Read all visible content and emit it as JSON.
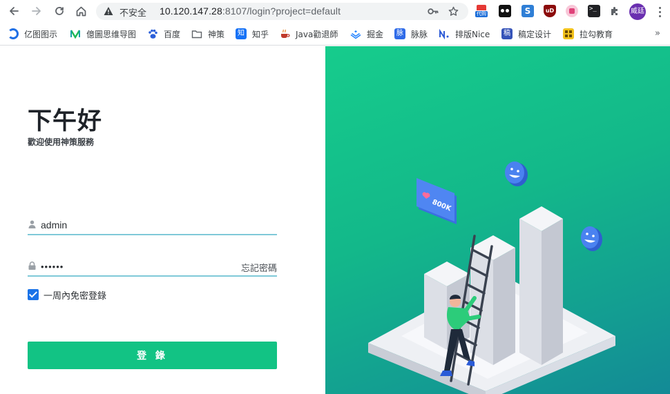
{
  "browser": {
    "security_label": "不安全",
    "url_host": "10.120.147.28",
    "url_rest": ":8107/login?project=default",
    "avatar_text": "威廷",
    "extensions": [
      "代购",
      "S",
      "uD"
    ],
    "bookmarks": [
      {
        "label": "亿图图示",
        "icon": "edraw-icon"
      },
      {
        "label": "億圖思维导图",
        "icon": "mindmaster-icon"
      },
      {
        "label": "百度",
        "icon": "baidu-paw-icon"
      },
      {
        "label": "神策",
        "icon": "folder-icon"
      },
      {
        "label": "知乎",
        "icon": "zhihu-icon"
      },
      {
        "label": "Java勸退師",
        "icon": "java-cup-icon"
      },
      {
        "label": "掘金",
        "icon": "juejin-icon"
      },
      {
        "label": "脉脉",
        "icon": "maimai-icon"
      },
      {
        "label": "排版Nice",
        "icon": "nice-icon"
      },
      {
        "label": "稿定设计",
        "icon": "gaoding-icon"
      },
      {
        "label": "拉勾教育",
        "icon": "lagou-icon"
      }
    ],
    "bookmark_icon_colors": [
      "#1f6fe5",
      "#1db954",
      "#2b5fd9",
      "#6b6f75",
      "#1772f6",
      "#c0392b",
      "#1e80ff",
      "#2f6be8",
      "#2d5bd6",
      "#3553b8",
      "#f2c21b"
    ],
    "more_label": "»"
  },
  "login": {
    "greeting": "下午好",
    "subtitle": "歡迎使用神策服務",
    "username_value": "admin",
    "password_value": "••••••",
    "forgot_label": "忘記密碼",
    "remember_label": "一周內免密登錄",
    "remember_checked": true,
    "submit_label": "登 錄",
    "accent_color": "#12c384"
  },
  "illustration": {
    "badge_text": "800K"
  }
}
